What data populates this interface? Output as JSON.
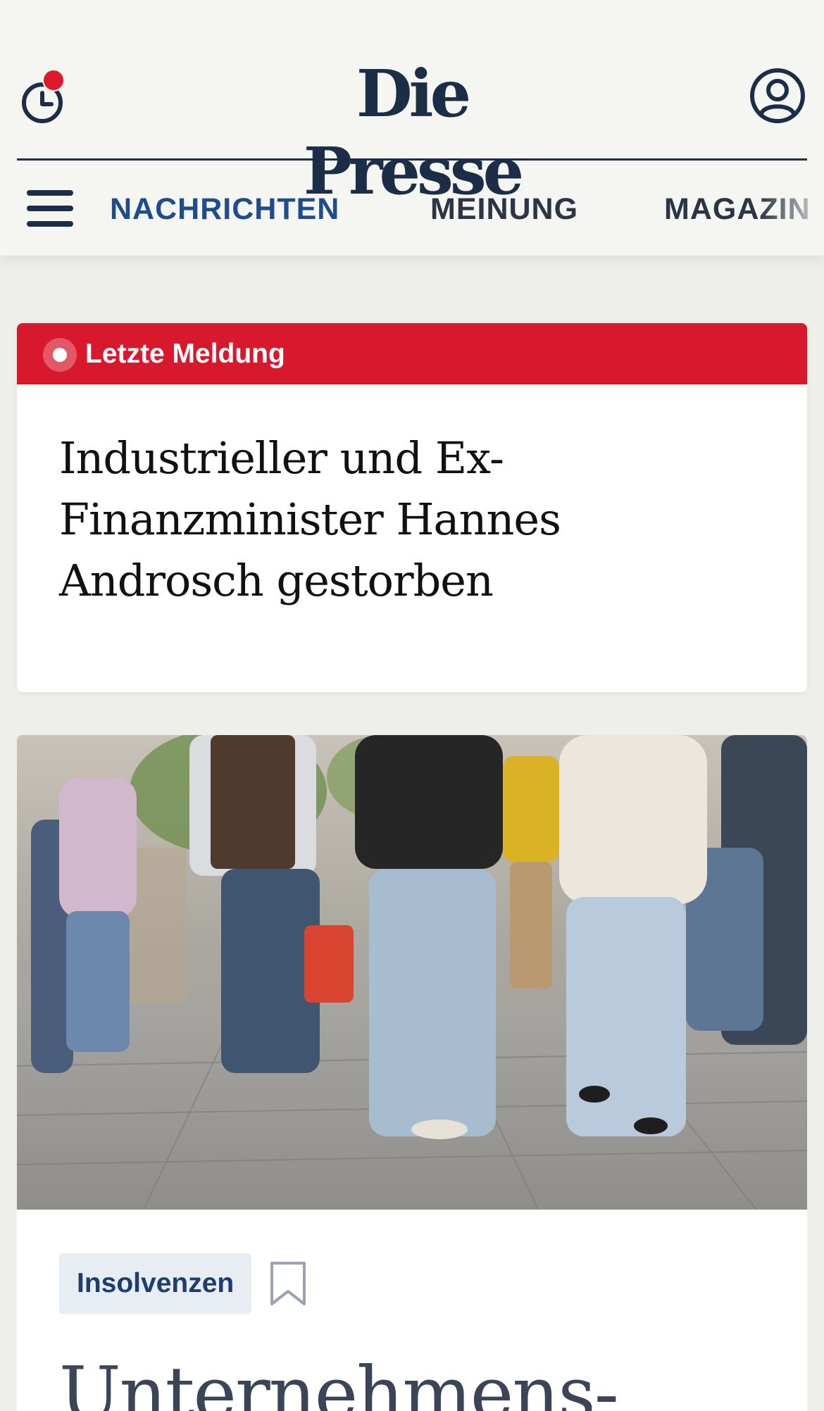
{
  "header": {
    "logo": "Die Presse",
    "history_icon": "clock-icon",
    "history_has_notification": true,
    "account_icon": "user-icon",
    "menu_icon": "hamburger-menu-icon"
  },
  "nav": {
    "items": [
      {
        "label": "NACHRICHTEN",
        "active": true
      },
      {
        "label": "MEINUNG",
        "active": false
      },
      {
        "label": "MAGAZIN",
        "active": false
      }
    ]
  },
  "breaking": {
    "label": "Letzte Meldung",
    "headline": "Industrieller und Ex-Finanzminister Hannes Androsch gestorben"
  },
  "article": {
    "image_alt": "Passanten in einer Fußgängerzone",
    "tag": "Insolvenzen",
    "bookmark_icon": "bookmark-icon",
    "headline": "Unternehmens-"
  },
  "colors": {
    "brand_navy": "#1c2d48",
    "nav_active": "#1f4c8a",
    "breaking_red": "#d8182c",
    "notification_red": "#e0182d",
    "page_bg": "#eeeeea",
    "tag_bg": "#e8edf3"
  }
}
